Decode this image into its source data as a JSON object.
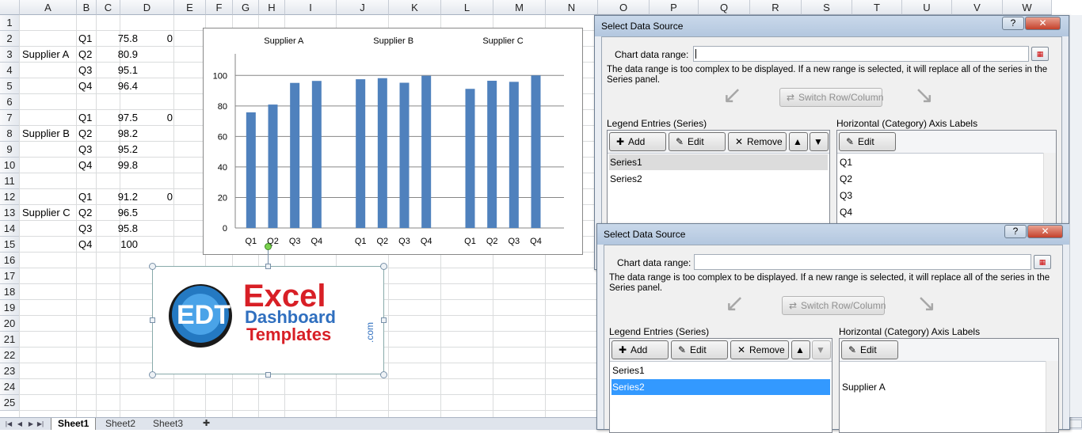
{
  "columns": [
    "A",
    "B",
    "C",
    "D",
    "E",
    "F",
    "G",
    "H",
    "I",
    "J",
    "K",
    "L",
    "M",
    "N",
    "O",
    "P",
    "Q",
    "R",
    "S",
    "T",
    "U",
    "V",
    "W"
  ],
  "rows": [
    "1",
    "2",
    "3",
    "4",
    "5",
    "6",
    "7",
    "8",
    "9",
    "10",
    "11",
    "12",
    "13",
    "14",
    "15",
    "16",
    "17",
    "18",
    "19",
    "20",
    "21",
    "22",
    "23",
    "24",
    "25"
  ],
  "cells": [
    {
      "row": 2,
      "b": "Q1",
      "c": "75.8",
      "d": "0"
    },
    {
      "row": 3,
      "a": "Supplier A",
      "b": "Q2",
      "c": "80.9"
    },
    {
      "row": 4,
      "b": "Q3",
      "c": "95.1"
    },
    {
      "row": 5,
      "b": "Q4",
      "c": "96.4"
    },
    {
      "row": 7,
      "b": "Q1",
      "c": "97.5",
      "d": "0"
    },
    {
      "row": 8,
      "a": "Supplier B",
      "b": "Q2",
      "c": "98.2"
    },
    {
      "row": 9,
      "b": "Q3",
      "c": "95.2"
    },
    {
      "row": 10,
      "b": "Q4",
      "c": "99.8"
    },
    {
      "row": 12,
      "b": "Q1",
      "c": "91.2",
      "d": "0"
    },
    {
      "row": 13,
      "a": "Supplier C",
      "b": "Q2",
      "c": "96.5"
    },
    {
      "row": 14,
      "b": "Q3",
      "c": "95.8"
    },
    {
      "row": 15,
      "b": "Q4",
      "c": "100"
    }
  ],
  "chart_data": {
    "type": "bar",
    "group_titles": [
      "Supplier A",
      "Supplier B",
      "Supplier C"
    ],
    "categories": [
      "Q1",
      "Q2",
      "Q3",
      "Q4",
      "Q1",
      "Q2",
      "Q3",
      "Q4",
      "Q1",
      "Q2",
      "Q3",
      "Q4"
    ],
    "series": [
      {
        "values": [
          75.8,
          80.9,
          95.1,
          96.4,
          97.5,
          98.2,
          95.2,
          99.8,
          91.2,
          96.5,
          95.8,
          100
        ]
      }
    ],
    "yticks": [
      "0",
      "20",
      "40",
      "60",
      "80",
      "100"
    ],
    "ylim": [
      0,
      110
    ],
    "grid": true,
    "color": "#4f81bd"
  },
  "logo": {
    "word1": "Excel",
    "word2": "Dashboard",
    "word3": "Templates",
    "suffix": ".com",
    "badge": "EDT"
  },
  "sheet_tabs": [
    "Sheet1",
    "Sheet2",
    "Sheet3"
  ],
  "dialog1": {
    "title": "Select Data Source",
    "help": "?",
    "close": "✕",
    "chart_range_label": "Chart data range:",
    "message": "The data range is too complex to be displayed. If a new range is selected, it will replace all of the series in the Series panel.",
    "switch_label": "Switch Row/Column",
    "legend_label": "Legend Entries (Series)",
    "axis_label": "Horizontal (Category) Axis Labels",
    "add": "Add",
    "edit": "Edit",
    "remove": "Remove",
    "axis_edit": "Edit",
    "series": [
      "Series1",
      "Series2"
    ],
    "categories": [
      "Q1",
      "Q2",
      "Q3",
      "Q4"
    ]
  },
  "dialog2": {
    "title": "Select Data Source",
    "help": "?",
    "close": "✕",
    "chart_range_label": "Chart data range:",
    "message": "The data range is too complex to be displayed. If a new range is selected, it will replace all of the series in the Series panel.",
    "switch_label": "Switch Row/Column",
    "legend_label": "Legend Entries (Series)",
    "axis_label": "Horizontal (Category) Axis Labels",
    "add": "Add",
    "edit": "Edit",
    "remove": "Remove",
    "axis_edit": "Edit",
    "series": [
      "Series1",
      "Series2"
    ],
    "categories": [
      "Supplier A"
    ]
  }
}
